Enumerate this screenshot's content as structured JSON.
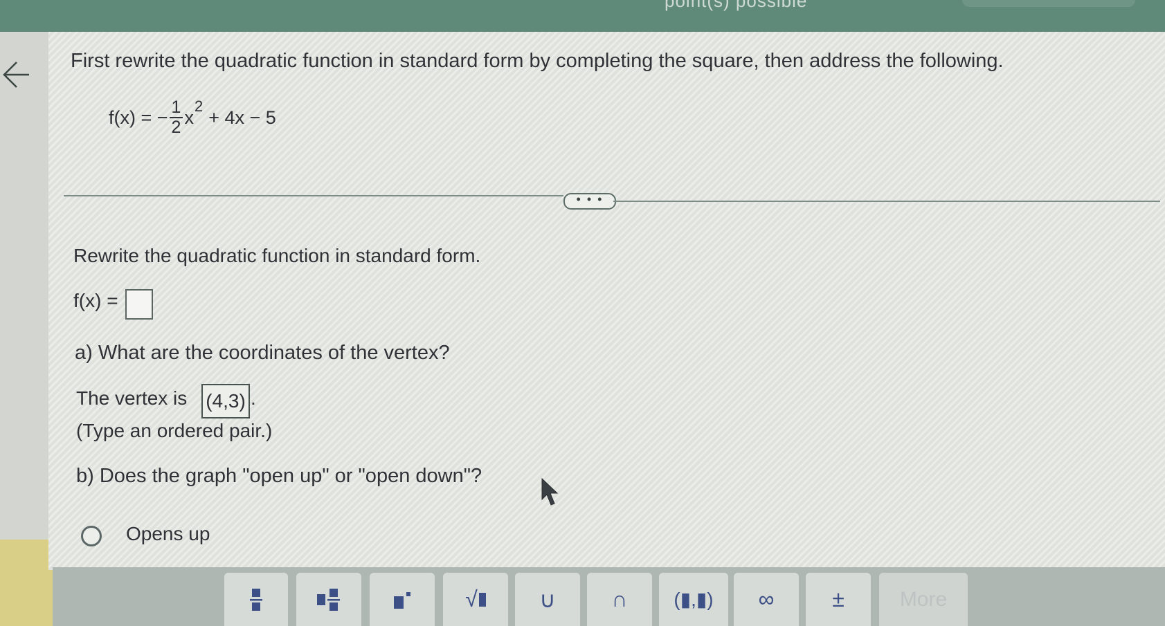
{
  "header": {
    "points_text": "point(s) possible"
  },
  "question": {
    "intro": "First rewrite the quadratic function in standard form by completing the square, then address the following.",
    "function": {
      "lhs": "f(x) = −",
      "fraction_num": "1",
      "fraction_den": "2",
      "variable": "x",
      "exponent": "2",
      "rest": "+ 4x − 5"
    }
  },
  "expand_button_label": "• • •",
  "part_standard_form": {
    "prompt": "Rewrite the quadratic function in standard form.",
    "label": "f(x) =",
    "answer_value": ""
  },
  "part_a": {
    "question": "a) What are the coordinates of the vertex?",
    "answer_prefix": "The vertex is",
    "answer_value": "(4,3)",
    "answer_suffix": ".",
    "hint": "(Type an ordered pair.)"
  },
  "part_b": {
    "question": "b) Does the graph \"open up\" or \"open down\"?",
    "options": [
      {
        "label": "Opens up",
        "selected": false
      }
    ]
  },
  "toolbar": {
    "buttons": [
      {
        "name": "fraction-icon",
        "glyph": ""
      },
      {
        "name": "mixed-number-icon",
        "glyph": ""
      },
      {
        "name": "exponent-icon",
        "glyph": ""
      },
      {
        "name": "square-root-icon",
        "glyph": "√"
      },
      {
        "name": "union-icon",
        "glyph": "∪"
      },
      {
        "name": "intersection-icon",
        "glyph": "∩"
      },
      {
        "name": "ordered-pair-icon",
        "glyph": "(▮,▮)"
      },
      {
        "name": "infinity-icon",
        "glyph": "∞"
      },
      {
        "name": "plus-minus-icon",
        "glyph": "±"
      },
      {
        "name": "more-button",
        "glyph": "More"
      }
    ]
  },
  "colors": {
    "header": "#5f8a7a",
    "panel": "#e6e8e3",
    "toolbar": "#afb7b3",
    "icon": "#3c4f86"
  }
}
